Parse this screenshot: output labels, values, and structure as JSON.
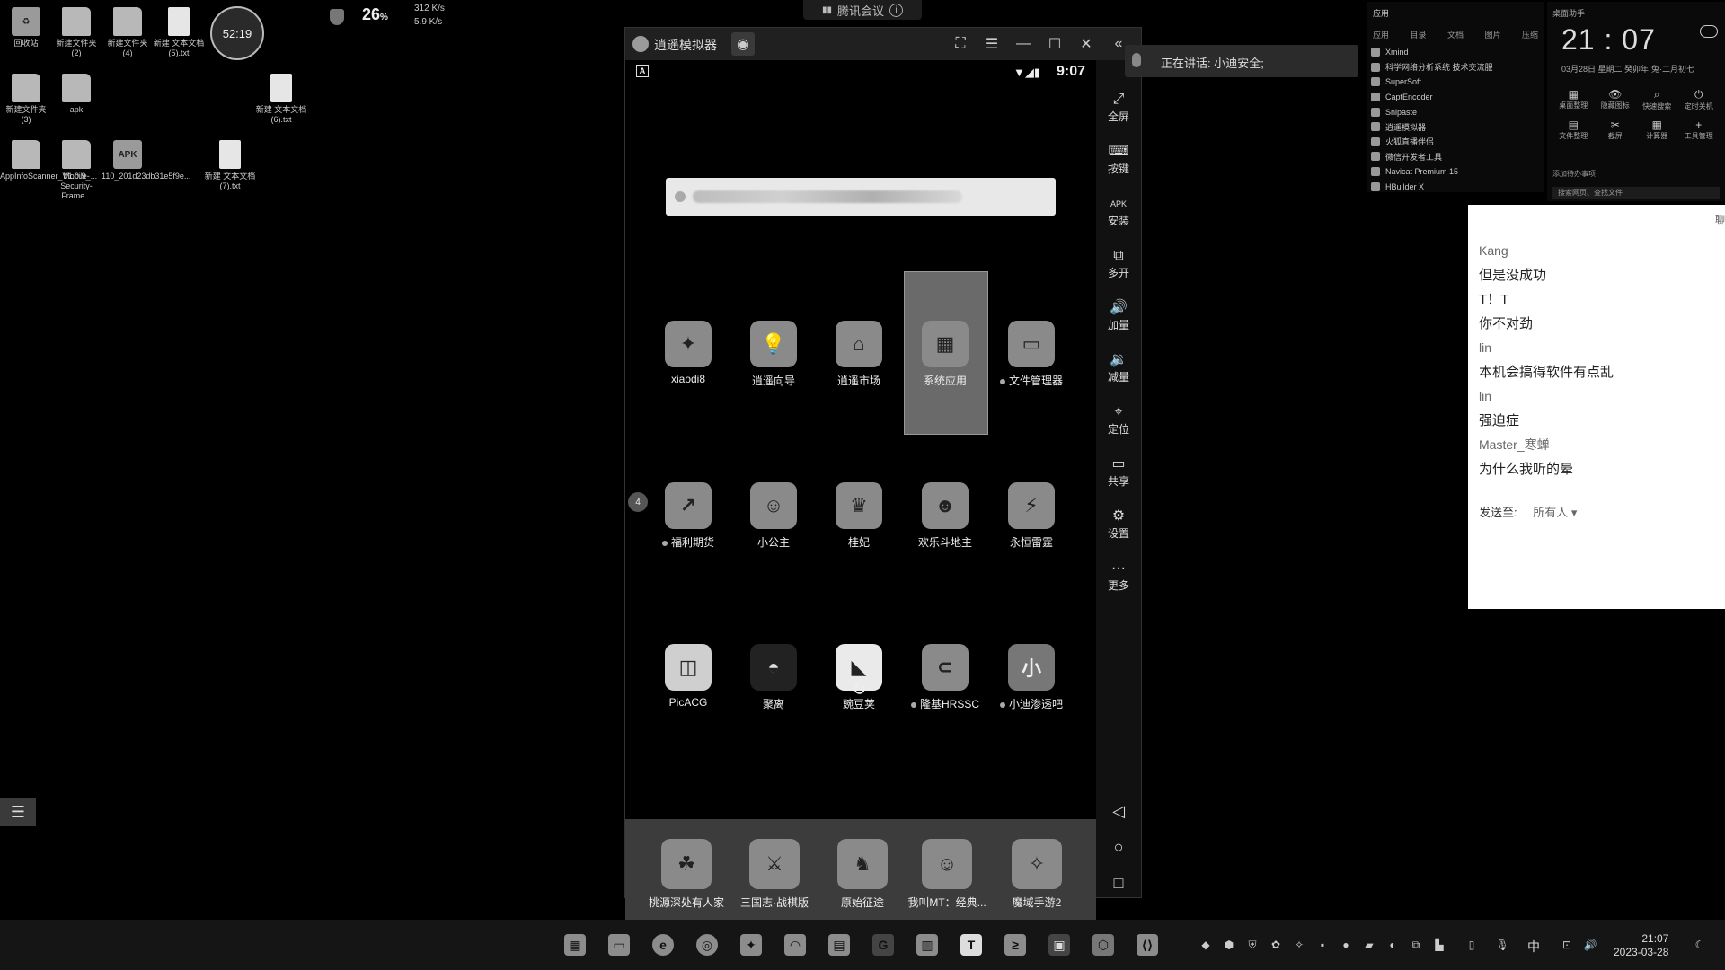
{
  "desktop": {
    "icons": [
      {
        "label": "回收站",
        "type": "bin"
      },
      {
        "label": "新建文件夹 (2)",
        "type": "folder"
      },
      {
        "label": "新建文件夹 (4)",
        "type": "folder"
      },
      {
        "label": "新建 文本文档 (5).txt",
        "type": "file"
      },
      {
        "label": "新建文件夹 (3)",
        "type": "folder"
      },
      {
        "label": "apk",
        "type": "folder"
      },
      {
        "label": "新建 文本文档 (6).txt",
        "type": "file"
      },
      {
        "label": "AppInfoScanner_V1.0.9_...",
        "type": "folder"
      },
      {
        "label": "Mobile-Security-Frame...",
        "type": "folder"
      },
      {
        "label": "110_201d23db31e5f9e...",
        "type": "apk"
      },
      {
        "label": "新建 文本文档 (7).txt",
        "type": "file"
      }
    ],
    "timer": "52:19",
    "net": {
      "percent": "26",
      "percent_unit": "%",
      "up": "312 K/s",
      "down": "5.9 K/s"
    },
    "meeting_label": "腾讯会议",
    "menu_icon": "☰"
  },
  "emulator": {
    "title": "逍遥模拟器",
    "status_time": "9:07",
    "status_a": "A",
    "apps_row1": [
      {
        "label": "xiaodi8",
        "glyph": "✦"
      },
      {
        "label": "逍遥向导",
        "glyph": "💡"
      },
      {
        "label": "逍遥市场",
        "glyph": "⌂"
      },
      {
        "label": "系统应用",
        "glyph": "▦",
        "selected": true
      },
      {
        "label": "文件管理器",
        "glyph": "▭",
        "dot": true
      }
    ],
    "apps_row2": [
      {
        "label": "福利期货",
        "glyph": "↗",
        "dot": true
      },
      {
        "label": "小公主",
        "glyph": "☺"
      },
      {
        "label": "桂妃",
        "glyph": "♛"
      },
      {
        "label": "欢乐斗地主",
        "glyph": "☻"
      },
      {
        "label": "永恒雷霆",
        "glyph": "⚡"
      }
    ],
    "apps_row3": [
      {
        "label": "PicACG",
        "glyph": "◫"
      },
      {
        "label": "聚离",
        "glyph": "◓"
      },
      {
        "label": "豌豆荚",
        "glyph": "◣"
      },
      {
        "label": "隆基HRSSC",
        "glyph": "⊂",
        "dot": true
      },
      {
        "label": "小迪渗透吧",
        "glyph": "小",
        "dot": true
      }
    ],
    "page_indicator": "4",
    "dock": [
      {
        "label": "桃源深处有人家",
        "glyph": "☘"
      },
      {
        "label": "三国志·战棋版",
        "glyph": "⚔"
      },
      {
        "label": "原始征途",
        "glyph": "♞"
      },
      {
        "label": "我叫MT：经典...",
        "glyph": "☺"
      },
      {
        "label": "魔域手游2",
        "glyph": "✧"
      }
    ],
    "sidebar": [
      {
        "label": "全屏",
        "glyph": "⤢"
      },
      {
        "label": "按键",
        "glyph": "⌨"
      },
      {
        "label": "安装",
        "glyph": "APK"
      },
      {
        "label": "多开",
        "glyph": "⧉"
      },
      {
        "label": "加量",
        "glyph": "🔊"
      },
      {
        "label": "减量",
        "glyph": "🔉"
      },
      {
        "label": "定位",
        "glyph": "⌖"
      },
      {
        "label": "共享",
        "glyph": "▭"
      },
      {
        "label": "设置",
        "glyph": "⚙"
      },
      {
        "label": "更多",
        "glyph": "···"
      }
    ]
  },
  "speaking": {
    "text": "正在讲话: 小迪安全;"
  },
  "apps_panel": {
    "header": "应用",
    "tabs": [
      "应用",
      "目录",
      "文档",
      "图片",
      "压缩"
    ],
    "items": [
      "Xmind",
      "科学网络分析系统 技术交流服",
      "SuperSoft",
      "CaptEncoder",
      "Snipaste",
      "逍遥模拟器",
      "火狐直播伴侣",
      "微信开发者工具",
      "Navicat Premium 15",
      "HBuilder X"
    ]
  },
  "clock_panel": {
    "label": "桌面助手",
    "time": "21 : 07",
    "date": "03月28日    星期二    癸卯年·兔·二月初七",
    "tools": [
      {
        "g": "▦",
        "l": "桌面整理"
      },
      {
        "g": "👁",
        "l": "隐藏图标"
      },
      {
        "g": "⌕",
        "l": "快速搜索"
      },
      {
        "g": "⏻",
        "l": "定时关机"
      },
      {
        "g": "▤",
        "l": "文件整理"
      },
      {
        "g": "✂",
        "l": "截屏"
      },
      {
        "g": "▦",
        "l": "计算器"
      },
      {
        "g": "+",
        "l": "工具管理"
      }
    ],
    "todo": "添加待办事项",
    "search": "搜索网页、查找文件"
  },
  "chat": {
    "top": "聊",
    "messages": [
      {
        "name": "Kang",
        "text": "但是没成功"
      },
      {
        "name": "",
        "text": "T！T"
      },
      {
        "name": "",
        "text": "你不对劲"
      },
      {
        "name": "lin",
        "text": "本机会搞得软件有点乱"
      },
      {
        "name": "lin",
        "text": "强迫症"
      },
      {
        "name": "Master_寒蝉",
        "text": "为什么我听的晕"
      }
    ],
    "send_label": "发送至:",
    "send_to": "所有人 ▾"
  },
  "taskbar": {
    "clock_time": "21:07",
    "clock_date": "2023-03-28",
    "ime": "中"
  }
}
